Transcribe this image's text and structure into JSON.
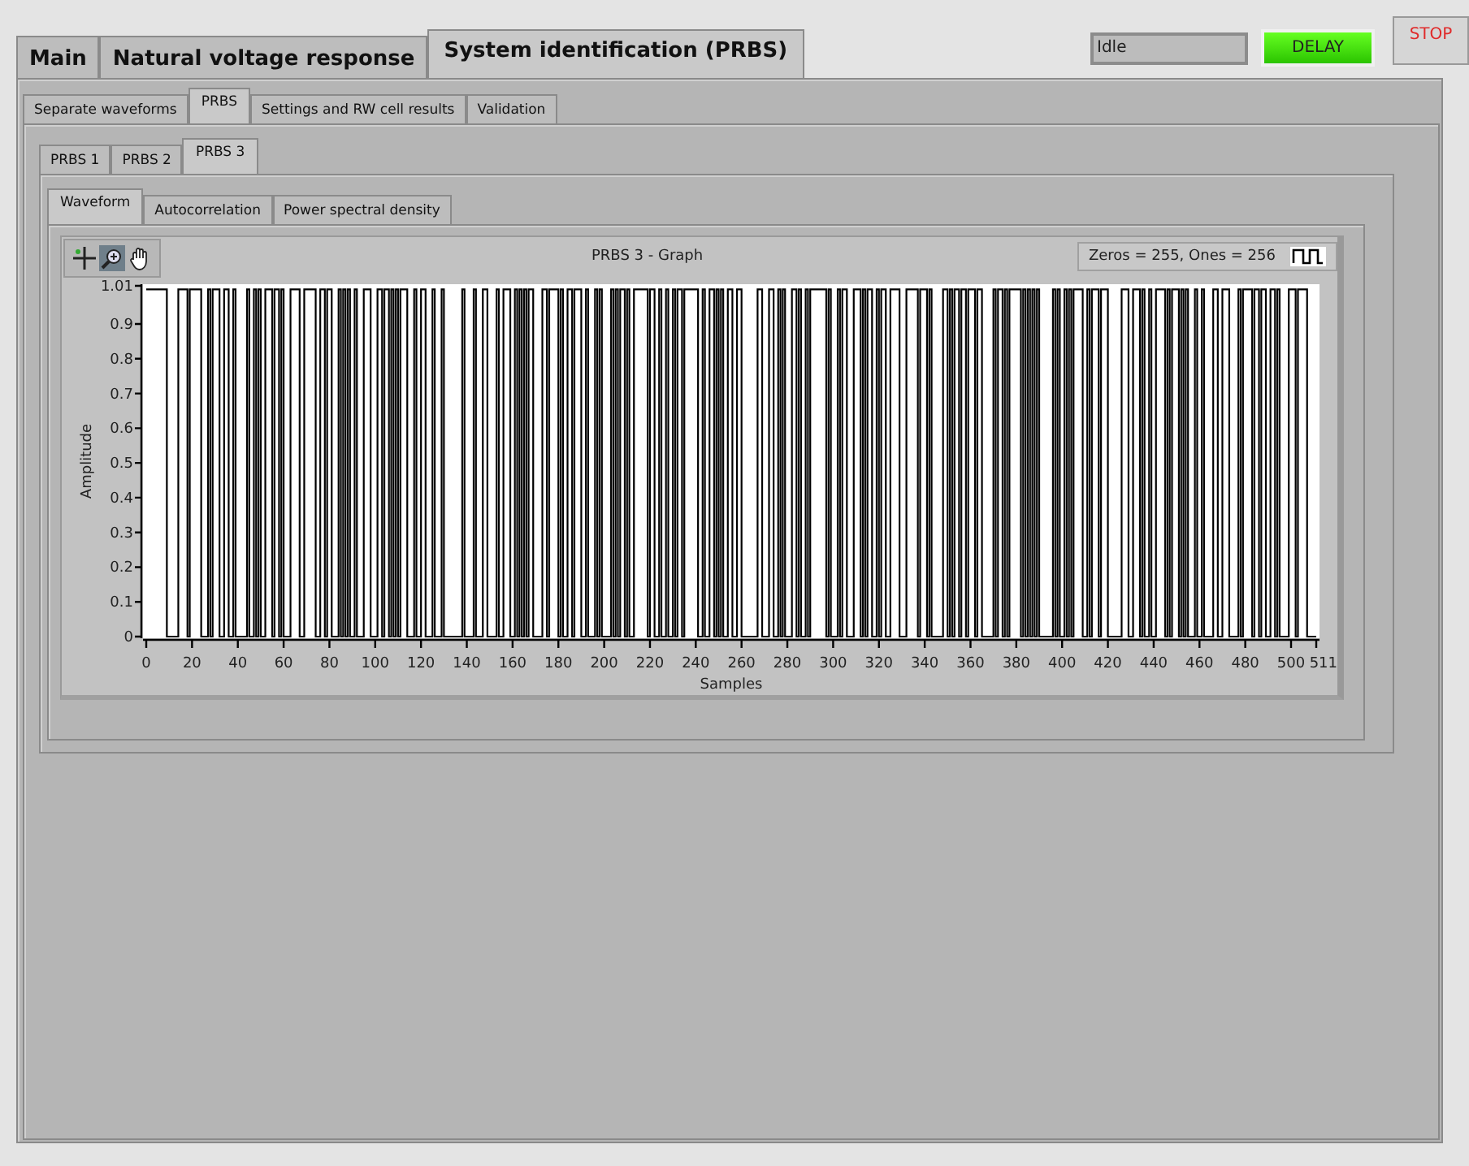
{
  "top_tabs": [
    {
      "label": "Main",
      "selected": false
    },
    {
      "label": "Natural voltage response",
      "selected": false
    },
    {
      "label": "System identification (PRBS)",
      "selected": true
    }
  ],
  "status_field": {
    "value": "Idle"
  },
  "delay_button": {
    "label": "DELAY",
    "on": true
  },
  "stop_button": {
    "label": "STOP"
  },
  "section_tabs": [
    {
      "label": "Separate waveforms",
      "selected": false
    },
    {
      "label": "PRBS",
      "selected": true
    },
    {
      "label": "Settings and RW cell results",
      "selected": false
    },
    {
      "label": "Validation",
      "selected": false
    }
  ],
  "prbs_tabs": [
    {
      "label": "PRBS 1",
      "selected": false
    },
    {
      "label": "PRBS 2",
      "selected": false
    },
    {
      "label": "PRBS 3",
      "selected": true
    }
  ],
  "view_tabs": [
    {
      "label": "Waveform",
      "selected": true
    },
    {
      "label": "Autocorrelation",
      "selected": false
    },
    {
      "label": "Power spectral density",
      "selected": false
    }
  ],
  "graph": {
    "title": "PRBS 3 - Graph",
    "legend": "Zeros = 255, Ones = 256",
    "xlabel": "Samples",
    "ylabel": "Amplitude",
    "yticks": [
      "1.01",
      "0.9",
      "0.8",
      "0.7",
      "0.6",
      "0.5",
      "0.4",
      "0.3",
      "0.2",
      "0.1",
      "0"
    ],
    "xticks": [
      "0",
      "20",
      "40",
      "60",
      "80",
      "100",
      "120",
      "140",
      "160",
      "180",
      "200",
      "220",
      "240",
      "260",
      "280",
      "300",
      "320",
      "340",
      "360",
      "380",
      "400",
      "420",
      "440",
      "460",
      "480",
      "500",
      "511"
    ]
  }
}
